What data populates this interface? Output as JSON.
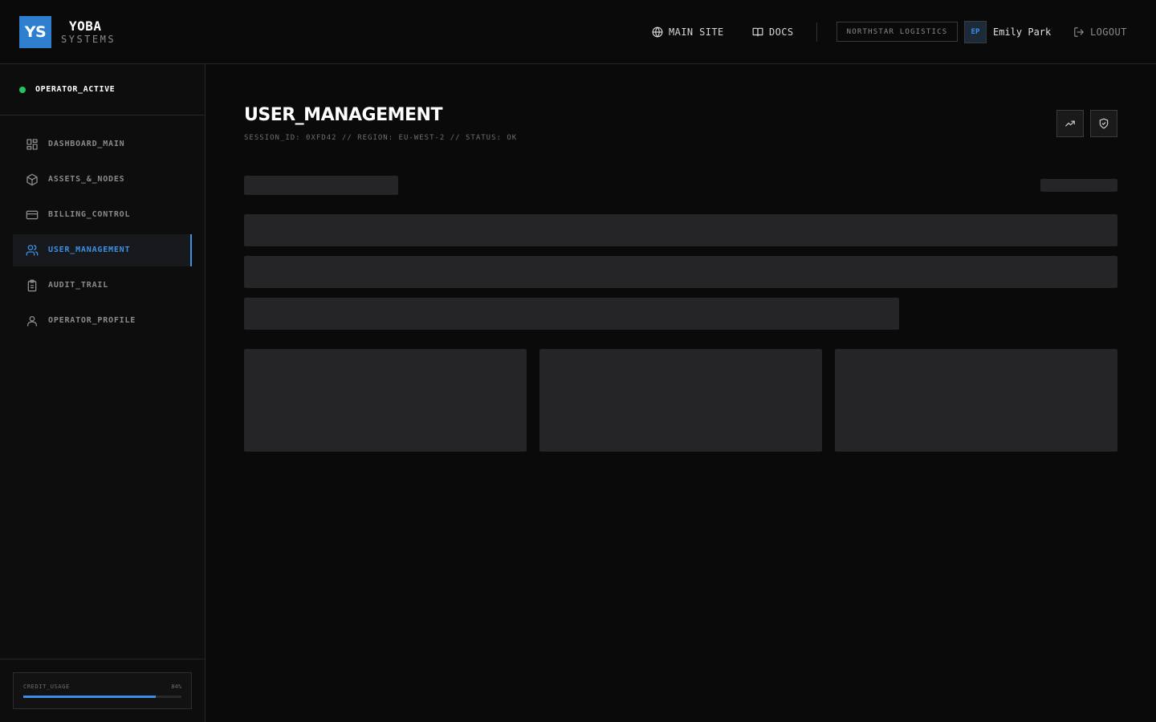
{
  "header": {
    "logo_initials": "YS",
    "logo_name": "YOBA",
    "logo_sub": "SYSTEMS",
    "nav": {
      "main_site": "MAIN SITE",
      "docs": "DOCS"
    },
    "org": "NORTHSTAR LOGISTICS",
    "user_initials": "EP",
    "user_name": "Emily Park",
    "logout": "LOGOUT"
  },
  "sidebar": {
    "status": "OPERATOR_ACTIVE",
    "status_color": "#22c55e",
    "items": [
      {
        "label": "DASHBOARD_MAIN",
        "icon": "dashboard-grid-icon",
        "active": false
      },
      {
        "label": "ASSETS_&_NODES",
        "icon": "cube-icon",
        "active": false
      },
      {
        "label": "BILLING_CONTROL",
        "icon": "credit-card-icon",
        "active": false
      },
      {
        "label": "USER_MANAGEMENT",
        "icon": "users-icon",
        "active": true
      },
      {
        "label": "AUDIT_TRAIL",
        "icon": "clipboard-icon",
        "active": false
      },
      {
        "label": "OPERATOR_PROFILE",
        "icon": "user-icon",
        "active": false
      }
    ],
    "credit": {
      "label": "CREDIT_USAGE",
      "value": "84%",
      "fraction": 0.84
    }
  },
  "main": {
    "title": "USER_MANAGEMENT",
    "meta": "SESSION_ID: 0XFD42 // REGION: EU-WEST-2 // STATUS: OK",
    "accent_color": "#3d8fe6"
  }
}
